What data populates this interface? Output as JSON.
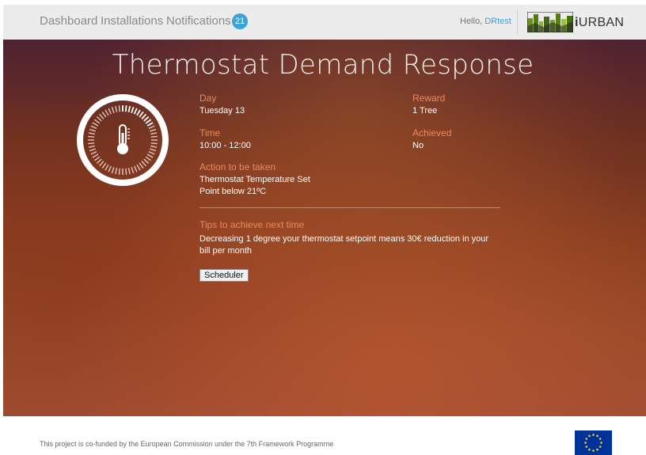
{
  "nav": {
    "links": [
      "Dashboard",
      "Installations",
      "Notifications"
    ],
    "notification_count": "21",
    "hello_prefix": "Hello, ",
    "username": "DRtest",
    "logo_text_bold": "i",
    "logo_text_rest": "URBAN"
  },
  "page": {
    "title": "Thermostat Demand Response"
  },
  "details": {
    "day_label": "Day",
    "day_value": "Tuesday 13",
    "time_label": "Time",
    "time_value": "10:00 - 12:00",
    "action_label": "Action to be taken",
    "action_line1": "Thermostat Temperature Set",
    "action_line2": "Point below 21ºC",
    "reward_label": "Reward",
    "reward_value": "1 Tree",
    "achieved_label": "Achieved",
    "achieved_value": "No",
    "tips_label": "Tips to achieve next time",
    "tips_line1": "Decreasing 1 degree your thermostat setpoint means 30€ reduction in your",
    "tips_line2": "bill per month",
    "scheduler_label": "Scheduler"
  },
  "footer": {
    "text": "This project is co-funded by the European Commission under the 7th Framework Programme"
  },
  "colors": {
    "accent_blue": "#3aa3d8",
    "label_orange": "#e88a62",
    "eu_blue": "#003399",
    "eu_star": "#ffcc00"
  },
  "icons": {
    "gauge": "thermometer-dial-icon",
    "logo": "city-skyline-logo",
    "flag": "eu-flag"
  }
}
